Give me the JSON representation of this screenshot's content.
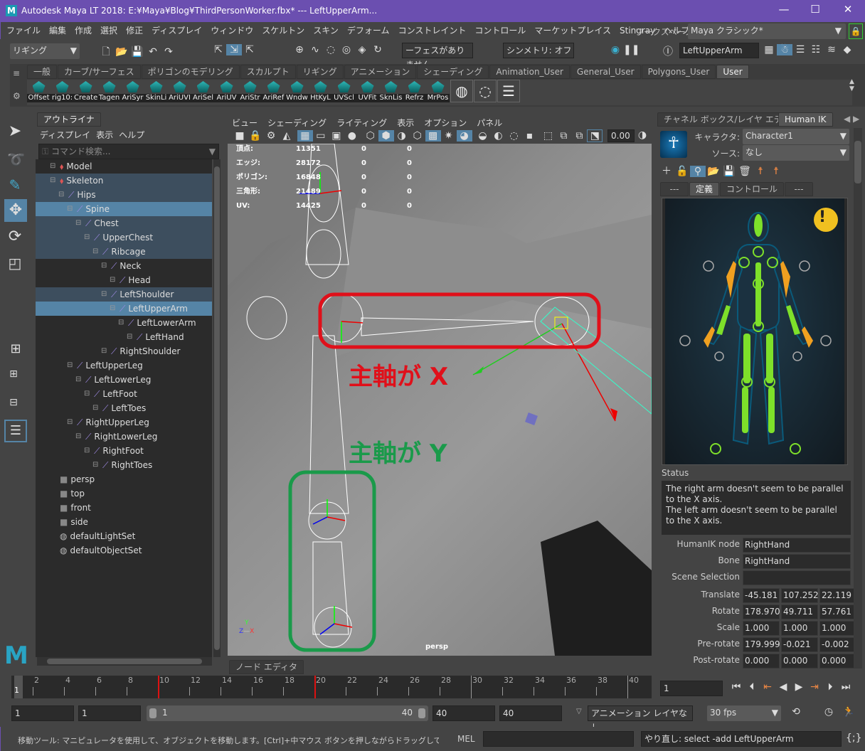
{
  "window": {
    "title": "Autodesk Maya LT 2018: E:¥Maya¥Blog¥ThirdPersonWorker.fbx*  ---  LeftUpperArm...",
    "min": "—",
    "max": "☐",
    "close": "✕"
  },
  "menu": [
    "ファイル",
    "編集",
    "作成",
    "選択",
    "修正",
    "ディスプレイ",
    "ウィンドウ",
    "スケルトン",
    "スキン",
    "デフォーム",
    "コンストレイント",
    "コントロール",
    "マーケットプレイス",
    "Stingray",
    "ヘルプ"
  ],
  "workspace": {
    "label": "ワークスペース:",
    "value": "Maya クラシック*"
  },
  "statusline": {
    "menuset": "リギング",
    "faces": "ーフェスがありません",
    "symmetry": "シンメトリ: オフ",
    "object_name": "LeftUpperArm"
  },
  "shelf": {
    "tabs": [
      "一般",
      "カーブ/サーフェス",
      "ポリゴンのモデリング",
      "スカルプト",
      "リギング",
      "アニメーション",
      "シェーディング",
      "Animation_User",
      "General_User",
      "Polygons_User",
      "User"
    ],
    "active_tab": "User",
    "buttons": [
      "Offset",
      "rig10:",
      "Create",
      "Tagen",
      "AriSyr",
      "SkinLi",
      "AriUVI",
      "AriSel",
      "AriUV",
      "AriStr",
      "AriRef",
      "Wndw",
      "HtKyL",
      "UVScl",
      "UVFit",
      "SknLis",
      "Refrz",
      "MrPos"
    ]
  },
  "outliner": {
    "title": "アウトライナ",
    "menu": [
      "ディスプレイ",
      "表示",
      "ヘルプ"
    ],
    "search_placeholder": "コマンド検索...",
    "items": [
      {
        "label": "Model",
        "depth": 0,
        "type": "group",
        "state": ""
      },
      {
        "label": "Skeleton",
        "depth": 0,
        "type": "group",
        "state": "dim"
      },
      {
        "label": "Hips",
        "depth": 1,
        "type": "joint",
        "state": "dim"
      },
      {
        "label": "Spine",
        "depth": 2,
        "type": "joint",
        "state": "hl"
      },
      {
        "label": "Chest",
        "depth": 3,
        "type": "joint",
        "state": "dim"
      },
      {
        "label": "UpperChest",
        "depth": 4,
        "type": "joint",
        "state": "dim"
      },
      {
        "label": "Ribcage",
        "depth": 5,
        "type": "joint",
        "state": "dim"
      },
      {
        "label": "Neck",
        "depth": 6,
        "type": "joint",
        "state": ""
      },
      {
        "label": "Head",
        "depth": 7,
        "type": "joint",
        "state": ""
      },
      {
        "label": "LeftShoulder",
        "depth": 6,
        "type": "joint",
        "state": "dim"
      },
      {
        "label": "LeftUpperArm",
        "depth": 7,
        "type": "joint",
        "state": "hl"
      },
      {
        "label": "LeftLowerArm",
        "depth": 8,
        "type": "joint",
        "state": ""
      },
      {
        "label": "LeftHand",
        "depth": 9,
        "type": "joint",
        "state": ""
      },
      {
        "label": "RightShoulder",
        "depth": 6,
        "type": "joint",
        "state": ""
      },
      {
        "label": "LeftUpperLeg",
        "depth": 2,
        "type": "joint",
        "state": ""
      },
      {
        "label": "LeftLowerLeg",
        "depth": 3,
        "type": "joint",
        "state": ""
      },
      {
        "label": "LeftFoot",
        "depth": 4,
        "type": "joint",
        "state": ""
      },
      {
        "label": "LeftToes",
        "depth": 5,
        "type": "joint",
        "state": ""
      },
      {
        "label": "RightUpperLeg",
        "depth": 2,
        "type": "joint",
        "state": ""
      },
      {
        "label": "RightLowerLeg",
        "depth": 3,
        "type": "joint",
        "state": ""
      },
      {
        "label": "RightFoot",
        "depth": 4,
        "type": "joint",
        "state": ""
      },
      {
        "label": "RightToes",
        "depth": 5,
        "type": "joint",
        "state": ""
      },
      {
        "label": "persp",
        "depth": 0,
        "type": "camera",
        "state": "gray"
      },
      {
        "label": "top",
        "depth": 0,
        "type": "camera",
        "state": "gray"
      },
      {
        "label": "front",
        "depth": 0,
        "type": "camera",
        "state": "gray"
      },
      {
        "label": "side",
        "depth": 0,
        "type": "camera",
        "state": "gray"
      },
      {
        "label": "defaultLightSet",
        "depth": 0,
        "type": "set",
        "state": ""
      },
      {
        "label": "defaultObjectSet",
        "depth": 0,
        "type": "set",
        "state": ""
      }
    ]
  },
  "viewport": {
    "menu": [
      "ビュー",
      "シェーディング",
      "ライティング",
      "表示",
      "オプション",
      "パネル"
    ],
    "exposure": "0.00",
    "hud": [
      [
        "頂点:",
        "11351",
        "0",
        "0"
      ],
      [
        "エッジ:",
        "28172",
        "0",
        "0"
      ],
      [
        "ポリゴン:",
        "16848",
        "0",
        "0"
      ],
      [
        "三角形:",
        "21489",
        "0",
        "0"
      ],
      [
        "UV:",
        "14425",
        "0",
        "0"
      ]
    ],
    "camera": "persp",
    "annotation_x": "主軸が X",
    "annotation_y": "主軸が Y",
    "annotation_x_color": "#e0101a",
    "annotation_y_color": "#1a9a4a",
    "axis_labels": {
      "y": "Y",
      "z": "Z",
      "x": "X"
    },
    "node_editor_tab": "ノード エディタ"
  },
  "hik": {
    "tabs": [
      "チャネル ボックス/レイヤ エディタ",
      "Human IK"
    ],
    "active_tab": "Human IK",
    "character_label": "キャラクタ:",
    "character": "Character1",
    "source_label": "ソース:",
    "source": "なし",
    "subtabs": [
      "---",
      "定義",
      "コントロール",
      "---"
    ],
    "active_subtab": "定義",
    "warning": "!",
    "status_label": "Status",
    "status_text": "The right arm doesn't seem to be parallel to the X axis.\nThe left arm doesn't seem to be parallel to the X axis.",
    "node_label": "HumanIK node",
    "node": "RightHand",
    "bone_label": "Bone",
    "bone": "RightHand",
    "scene_sel_label": "Scene Selection",
    "scene_sel": "",
    "attrs": [
      {
        "label": "Translate",
        "v": [
          "-45.181",
          "107.252",
          "22.119"
        ]
      },
      {
        "label": "Rotate",
        "v": [
          "178.970",
          "49.711",
          "57.761"
        ]
      },
      {
        "label": "Scale",
        "v": [
          "1.000",
          "1.000",
          "1.000"
        ]
      },
      {
        "label": "Pre-rotate",
        "v": [
          "179.999",
          "-0.021",
          "-0.002"
        ]
      },
      {
        "label": "Post-rotate",
        "v": [
          "0.000",
          "0.000",
          "0.000"
        ]
      }
    ]
  },
  "timeline": {
    "ticks": [
      "2",
      "4",
      "6",
      "8",
      "10",
      "12",
      "14",
      "16",
      "18",
      "20",
      "22",
      "24",
      "26",
      "28",
      "30",
      "32",
      "34",
      "36",
      "38",
      "40"
    ],
    "current": "1",
    "current_field": "1",
    "keys": [
      10,
      20
    ]
  },
  "range": {
    "start": "1",
    "play_start": "1",
    "slider_start": "1",
    "slider_end": "40",
    "play_end": "40",
    "end": "40",
    "anim_layer": "アニメーション レイヤなし",
    "fps": "30 fps"
  },
  "helpline": {
    "text": "移動ツール: マニピュレータを使用して、オブジェクトを移動します。[Ctrl]+中マウス ボタンを押しながらドラッグして、法線に沿ってコンポーネ",
    "mel_label": "MEL",
    "mel_input": "",
    "result": "やり直し: select -add LeftUpperArm"
  }
}
